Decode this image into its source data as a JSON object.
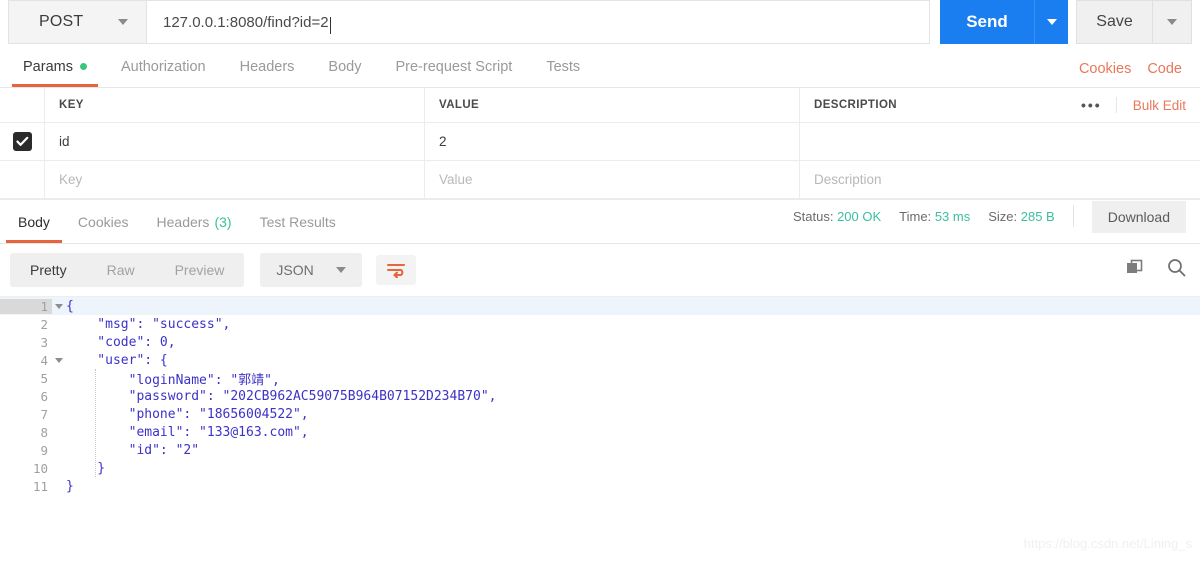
{
  "request": {
    "method": "POST",
    "url": "127.0.0.1:8080/find?id=2",
    "send_label": "Send",
    "save_label": "Save"
  },
  "request_tabs": [
    {
      "label": "Params",
      "active": true,
      "has_dot": true
    },
    {
      "label": "Authorization",
      "active": false,
      "has_dot": false
    },
    {
      "label": "Headers",
      "active": false,
      "has_dot": false
    },
    {
      "label": "Body",
      "active": false,
      "has_dot": false
    },
    {
      "label": "Pre-request Script",
      "active": false,
      "has_dot": false
    },
    {
      "label": "Tests",
      "active": false,
      "has_dot": false
    }
  ],
  "tabs_right": {
    "cookies": "Cookies",
    "code": "Code"
  },
  "params_table": {
    "headers": {
      "key": "KEY",
      "value": "VALUE",
      "description": "DESCRIPTION"
    },
    "more_icon": "•••",
    "bulk_edit": "Bulk Edit",
    "rows": [
      {
        "checked": true,
        "key": "id",
        "value": "2",
        "description": ""
      }
    ],
    "placeholders": {
      "key": "Key",
      "value": "Value",
      "description": "Description"
    }
  },
  "response_tabs": [
    {
      "label": "Body",
      "active": true,
      "count": ""
    },
    {
      "label": "Cookies",
      "active": false,
      "count": ""
    },
    {
      "label": "Headers",
      "active": false,
      "count": "(3)"
    },
    {
      "label": "Test Results",
      "active": false,
      "count": ""
    }
  ],
  "response_status": {
    "status_label": "Status:",
    "status_value": "200 OK",
    "time_label": "Time:",
    "time_value": "53 ms",
    "size_label": "Size:",
    "size_value": "285 B",
    "download_label": "Download"
  },
  "format_bar": {
    "segments": [
      {
        "label": "Pretty",
        "active": true
      },
      {
        "label": "Raw",
        "active": false
      },
      {
        "label": "Preview",
        "active": false
      }
    ],
    "language": "JSON",
    "wrap_icon": "word-wrap-icon",
    "copy_icon": "copy-icon",
    "search_icon": "search-icon"
  },
  "response_body": {
    "language": "json",
    "lines": [
      {
        "num": "1",
        "fold": true,
        "text": "{"
      },
      {
        "num": "2",
        "fold": false,
        "text": "    \"msg\": \"success\","
      },
      {
        "num": "3",
        "fold": false,
        "text": "    \"code\": 0,"
      },
      {
        "num": "4",
        "fold": true,
        "text": "    \"user\": {"
      },
      {
        "num": "5",
        "fold": false,
        "text": "        \"loginName\": \"郭靖\","
      },
      {
        "num": "6",
        "fold": false,
        "text": "        \"password\": \"202CB962AC59075B964B07152D234B70\","
      },
      {
        "num": "7",
        "fold": false,
        "text": "        \"phone\": \"18656004522\","
      },
      {
        "num": "8",
        "fold": false,
        "text": "        \"email\": \"133@163.com\","
      },
      {
        "num": "9",
        "fold": false,
        "text": "        \"id\": \"2\""
      },
      {
        "num": "10",
        "fold": false,
        "text": "    }"
      },
      {
        "num": "11",
        "fold": false,
        "text": "}"
      }
    ],
    "parsed": {
      "msg": "success",
      "code": 0,
      "user": {
        "loginName": "郭靖",
        "password": "202CB962AC59075B964B07152D234B70",
        "phone": "18656004522",
        "email": "133@163.com",
        "id": "2"
      }
    }
  },
  "watermark": "https://blog.csdn.net/Lining_s",
  "colors": {
    "accent_orange": "#e8643c",
    "send_blue": "#1a7ef1",
    "status_teal": "#3cbf9e",
    "dot_green": "#3cc47c",
    "json_key": "#3b2fa8",
    "json_string": "#4a52e0"
  }
}
